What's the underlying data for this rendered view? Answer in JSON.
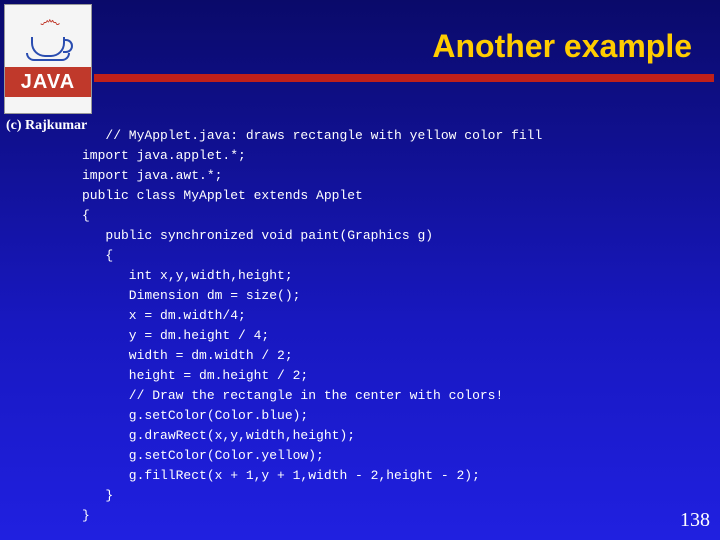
{
  "logo": {
    "text": "JAVA"
  },
  "title": "Another example",
  "copyright": "(c) Rajkumar",
  "code_lines": [
    {
      "indent": 1,
      "text": "// MyApplet.java: draws rectangle with yellow color fill"
    },
    {
      "indent": 0,
      "text": "import java.applet.*;"
    },
    {
      "indent": 0,
      "text": "import java.awt.*;"
    },
    {
      "indent": 0,
      "text": "public class MyApplet extends Applet"
    },
    {
      "indent": 0,
      "text": "{"
    },
    {
      "indent": 1,
      "text": "public synchronized void paint(Graphics g)"
    },
    {
      "indent": 1,
      "text": "{"
    },
    {
      "indent": 2,
      "text": "int x,y,width,height;"
    },
    {
      "indent": 2,
      "text": "Dimension dm = size();"
    },
    {
      "indent": 2,
      "text": "x = dm.width/4;"
    },
    {
      "indent": 2,
      "text": "y = dm.height / 4;"
    },
    {
      "indent": 2,
      "text": "width = dm.width / 2;"
    },
    {
      "indent": 2,
      "text": "height = dm.height / 2;"
    },
    {
      "indent": 2,
      "text": "// Draw the rectangle in the center with colors!"
    },
    {
      "indent": 2,
      "text": "g.setColor(Color.blue);"
    },
    {
      "indent": 2,
      "text": "g.drawRect(x,y,width,height);"
    },
    {
      "indent": 2,
      "text": "g.setColor(Color.yellow);"
    },
    {
      "indent": 2,
      "text": "g.fillRect(x + 1,y + 1,width - 2,height - 2);"
    },
    {
      "indent": 1,
      "text": "}"
    },
    {
      "indent": 0,
      "text": "}"
    }
  ],
  "page_number": "138"
}
